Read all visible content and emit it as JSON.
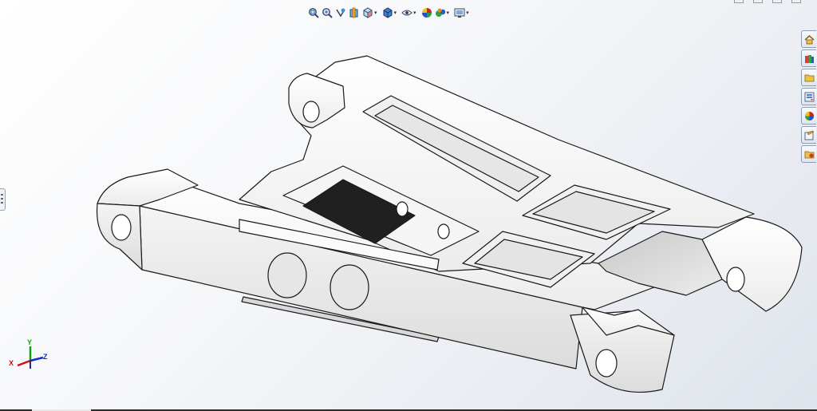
{
  "view_toolbar": {
    "buttons": [
      {
        "name": "zoom-to-fit",
        "has_dropdown": false
      },
      {
        "name": "zoom-to-area",
        "has_dropdown": false
      },
      {
        "name": "previous-view",
        "has_dropdown": false
      },
      {
        "name": "section-view",
        "has_dropdown": false
      },
      {
        "name": "view-orientation",
        "has_dropdown": true
      },
      {
        "name": "display-style",
        "has_dropdown": true
      },
      {
        "name": "hide-show-items",
        "has_dropdown": true
      },
      {
        "name": "edit-appearance",
        "has_dropdown": false
      },
      {
        "name": "apply-scene",
        "has_dropdown": true
      },
      {
        "name": "view-settings",
        "has_dropdown": true
      }
    ],
    "dropdown_glyph": "▾"
  },
  "task_pane": {
    "tabs": [
      "home-icon",
      "parts-library-icon",
      "file-explorer-icon",
      "view-palette-icon",
      "appearances-icon",
      "custom-properties-icon",
      "forum-icon"
    ]
  },
  "triad": {
    "x_label": "X",
    "y_label": "Y",
    "z_label": "Z"
  },
  "colors": {
    "background_top": "#ffffff",
    "background_bottom": "#dfe4ec",
    "model_fill": "#f7f7f7",
    "model_edge": "#1a1a1a",
    "triad_x": "#d01010",
    "triad_y": "#10a010",
    "triad_z": "#1030d0"
  }
}
